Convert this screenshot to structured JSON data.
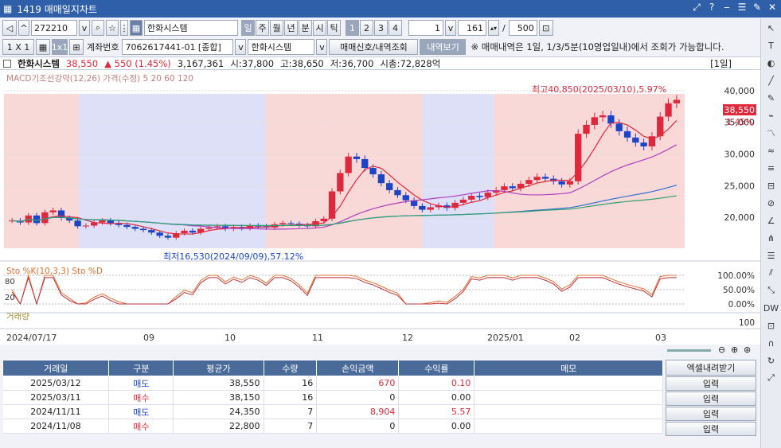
{
  "window": {
    "title": "1419 매매일지차트",
    "icons": [
      "link-icon",
      "help-icon",
      "minimize-icon",
      "menu-icon",
      "pin-icon",
      "close-icon"
    ],
    "icon_glyphs": [
      "⤢",
      "?",
      "‒",
      "☰",
      "✎",
      "✕"
    ]
  },
  "toolbar": {
    "code": "272210",
    "name": "한화시스템",
    "periods": [
      "일",
      "주",
      "월",
      "년",
      "분",
      "시",
      "틱"
    ],
    "nums": [
      "1",
      "2",
      "3",
      "4"
    ],
    "count1": "1",
    "count2": "161",
    "slash": "/",
    "count3": "500"
  },
  "toolbar2": {
    "scale": "1 X 1",
    "mode": "1x1",
    "account_label": "계좌번호",
    "account": "7062617441-01 [종합]",
    "name2": "한화시스템",
    "btn_signal": "매매신호/내역조회",
    "btn_history": "내역보기",
    "notice": "※ 매매내역은 1일, 1/3/5분(10영업일내)에서 조회가 가능합니다."
  },
  "info": {
    "name": "한화시스템",
    "price": "38,550",
    "change": "▲ 550 (1.45%)",
    "volume": "3,167,361",
    "open": "시:37,800",
    "high": "고:38,650",
    "low": "저:36,700",
    "amount": "시총:72,828억",
    "period": "[1일]"
  },
  "colors": {
    "up": "#e0283c",
    "down": "#1b44c8"
  },
  "chart_data": {
    "type": "candlestick",
    "main_legend": {
      "parts": [
        "MACD기조선강약(12,26)",
        "가격(수정)",
        "5",
        "20",
        "60",
        "120"
      ]
    },
    "ylim": [
      15000,
      42000
    ],
    "yticks": [
      "40,000",
      "35,000",
      "30,000",
      "25,000",
      "20,000"
    ],
    "ytick_values": [
      40000,
      35000,
      30000,
      25000,
      20000
    ],
    "xticks": [
      "2024/07/17",
      "09",
      "10",
      "11",
      "12",
      "2025/01",
      "02",
      "03"
    ],
    "annotations": {
      "high": "최고40,850(2025/03/10),5.97%",
      "low": "최저16,530(2024/09/09),57.12%",
      "price_tag": "38,550",
      "pct_tag": "1.45%"
    },
    "bg_bands": [
      [
        0,
        0.11,
        "#f9d8d8"
      ],
      [
        0.11,
        0.16,
        "#dde0f7"
      ],
      [
        0.16,
        0.385,
        "#dde0f7"
      ],
      [
        0.385,
        0.465,
        "#f9d8d8"
      ],
      [
        0.465,
        0.615,
        "#f9d8d8"
      ],
      [
        0.615,
        0.72,
        "#dde0f7"
      ],
      [
        0.72,
        1,
        "#f9d8d8"
      ]
    ],
    "close": [
      19500,
      19200,
      20300,
      19100,
      20800,
      21100,
      19900,
      19500,
      18600,
      18700,
      19200,
      19500,
      19100,
      18800,
      18500,
      18200,
      18000,
      17600,
      17100,
      16800,
      17500,
      17900,
      17600,
      18200,
      18400,
      18600,
      18200,
      18500,
      18300,
      18700,
      18600,
      18400,
      18900,
      19100,
      19000,
      18800,
      18600,
      19400,
      19800,
      24100,
      27000,
      29600,
      29200,
      27800,
      26800,
      25400,
      24300,
      23500,
      22700,
      21800,
      21200,
      21600,
      21900,
      21500,
      22300,
      22800,
      23400,
      23200,
      23900,
      24300,
      24900,
      24600,
      25300,
      25900,
      26400,
      26100,
      25700,
      25200,
      25700,
      33200,
      34600,
      35800,
      36100,
      34800,
      33600,
      32600,
      31800,
      31200,
      32800,
      35900,
      38000,
      38550
    ],
    "stoch_legend": "Sto %K(10,3,3)  Sto %D",
    "stoch_ticks": [
      "100.00%",
      "50.00%",
      "0.00%"
    ],
    "stoch_left": [
      "80",
      "20"
    ],
    "vol_legend": "거래량",
    "vol_tick": "100"
  },
  "table": {
    "headers": [
      "거래일",
      "구분",
      "평균가",
      "수량",
      "손익금액",
      "수익률",
      "메모"
    ],
    "rows": [
      {
        "date": "2025/03/12",
        "type": "매도",
        "price": "38,550",
        "qty": "16",
        "pnl": "670",
        "rate": "0.10",
        "memo": ""
      },
      {
        "date": "2025/03/11",
        "type": "매수",
        "price": "38,150",
        "qty": "16",
        "pnl": "0",
        "rate": "0.00",
        "memo": ""
      },
      {
        "date": "2024/11/11",
        "type": "매도",
        "price": "24,350",
        "qty": "7",
        "pnl": "8,904",
        "rate": "5.57",
        "memo": ""
      },
      {
        "date": "2024/11/08",
        "type": "매수",
        "price": "22,800",
        "qty": "7",
        "pnl": "0",
        "rate": "0.00",
        "memo": ""
      }
    ]
  },
  "side": {
    "excel": "엑셀내려받기",
    "input": "입력"
  }
}
